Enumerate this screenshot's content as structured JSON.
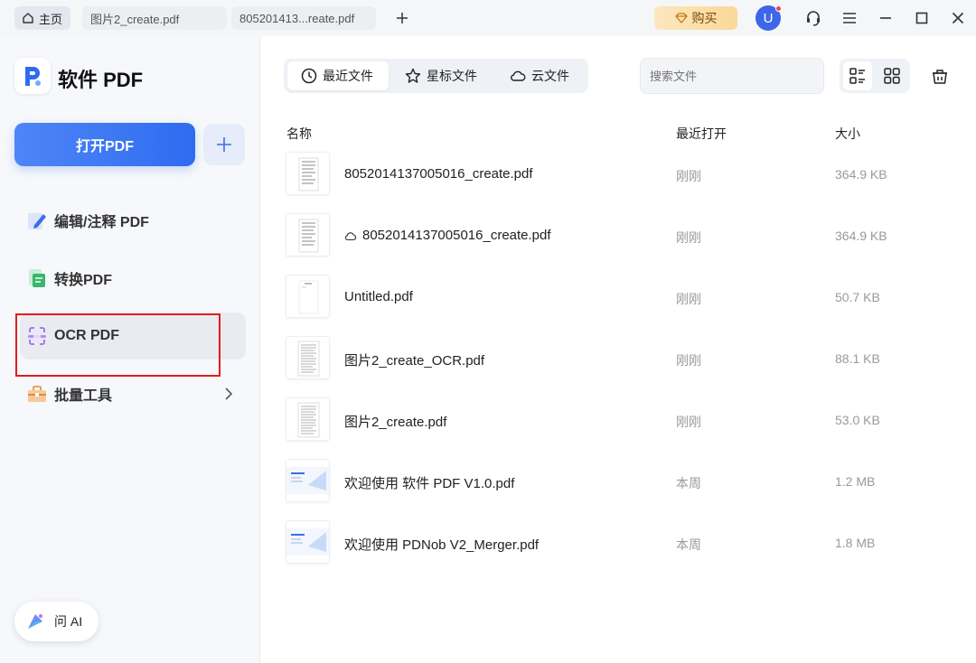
{
  "tabs": {
    "home": "主页",
    "file1": "图片2_create.pdf",
    "file2": "805201413...reate.pdf"
  },
  "titlebar": {
    "buy_label": "购买",
    "avatar_letter": "U",
    "buy_color": "#fbd89a",
    "avatar_color": "#3d66e8"
  },
  "sidebar": {
    "app_name": "软件 PDF",
    "open_label": "打开PDF",
    "items": [
      {
        "label": "编辑/注释 PDF",
        "icon": "edit-icon"
      },
      {
        "label": "转换PDF",
        "icon": "convert-icon"
      },
      {
        "label": "OCR PDF",
        "icon": "ocr-icon",
        "selected": true
      },
      {
        "label": "批量工具",
        "icon": "toolbox-icon"
      }
    ],
    "ai_label": "问 AI",
    "accent_color": "#2f6bf0"
  },
  "main": {
    "segments": {
      "recent": "最近文件",
      "starred": "星标文件",
      "cloud": "云文件"
    },
    "search_placeholder": "搜索文件",
    "columns": {
      "name": "名称",
      "opened": "最近打开",
      "size": "大小"
    },
    "files": [
      {
        "name": "8052014137005016_create.pdf",
        "opened": "刚刚",
        "size": "364.9 KB",
        "cloud": false
      },
      {
        "name": "8052014137005016_create.pdf",
        "opened": "刚刚",
        "size": "364.9 KB",
        "cloud": true
      },
      {
        "name": "Untitled.pdf",
        "opened": "刚刚",
        "size": "50.7 KB",
        "cloud": false
      },
      {
        "name": "图片2_create_OCR.pdf",
        "opened": "刚刚",
        "size": "88.1 KB",
        "cloud": false
      },
      {
        "name": "图片2_create.pdf",
        "opened": "刚刚",
        "size": "53.0 KB",
        "cloud": false
      },
      {
        "name": "欢迎使用 软件 PDF V1.0.pdf",
        "opened": "本周",
        "size": "1.2 MB",
        "cloud": false
      },
      {
        "name": "欢迎使用 PDNob V2_Merger.pdf",
        "opened": "本周",
        "size": "1.8 MB",
        "cloud": false
      }
    ]
  }
}
